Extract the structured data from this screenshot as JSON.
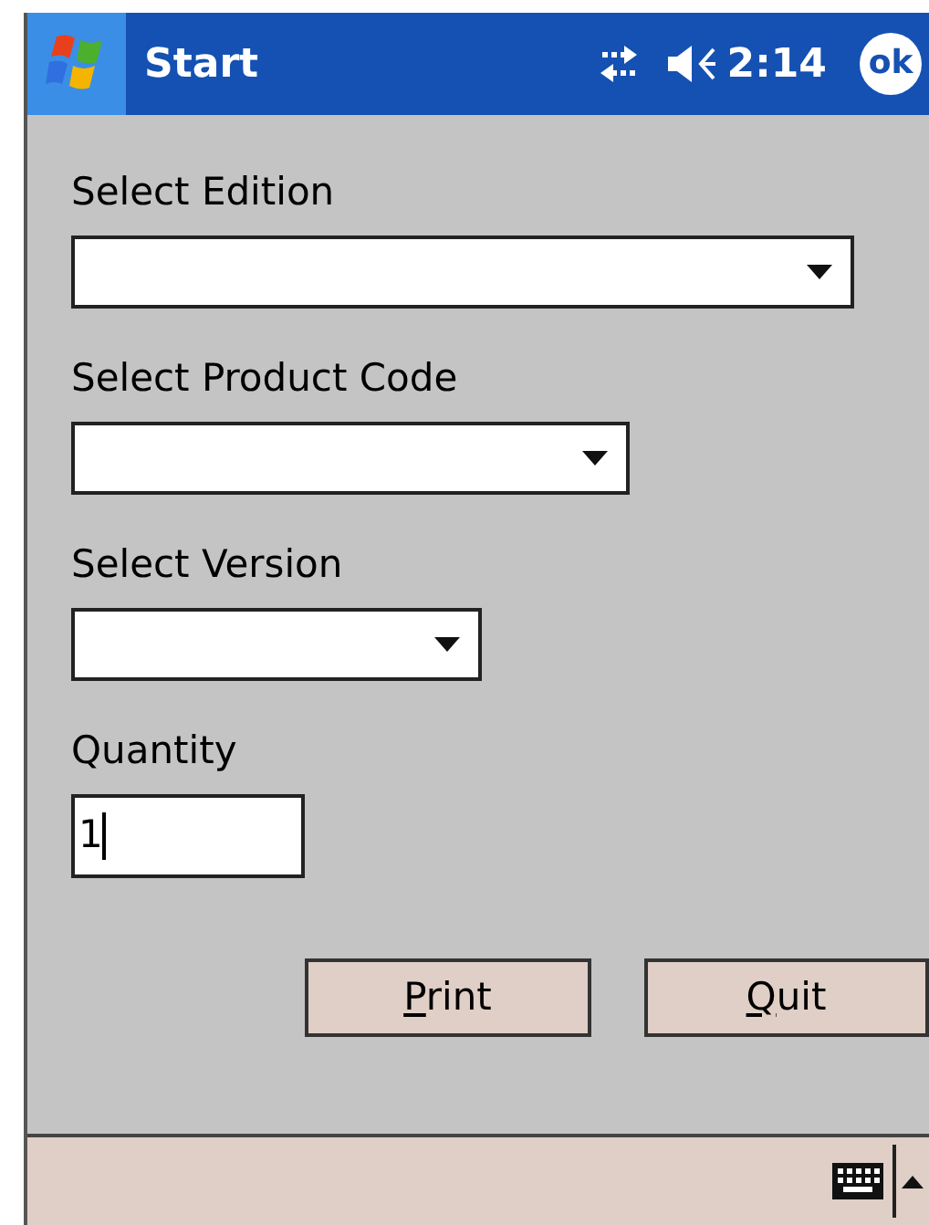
{
  "title_bar": {
    "title": "Start",
    "time": "2:14",
    "ok_button": "ok"
  },
  "fields": [
    {
      "kind": "dropdown",
      "label": "Select Edition"
    },
    {
      "kind": "dropdown",
      "label": "Select Product Code"
    },
    {
      "kind": "dropdown",
      "label": "Select Version"
    },
    {
      "kind": "text",
      "label": "Quantity",
      "value": "1",
      "focused": true
    }
  ],
  "buttons": [
    {
      "label": "Print",
      "first_letter_underlined": true
    },
    {
      "label": "Quit",
      "first_letter_underlined": true
    }
  ]
}
